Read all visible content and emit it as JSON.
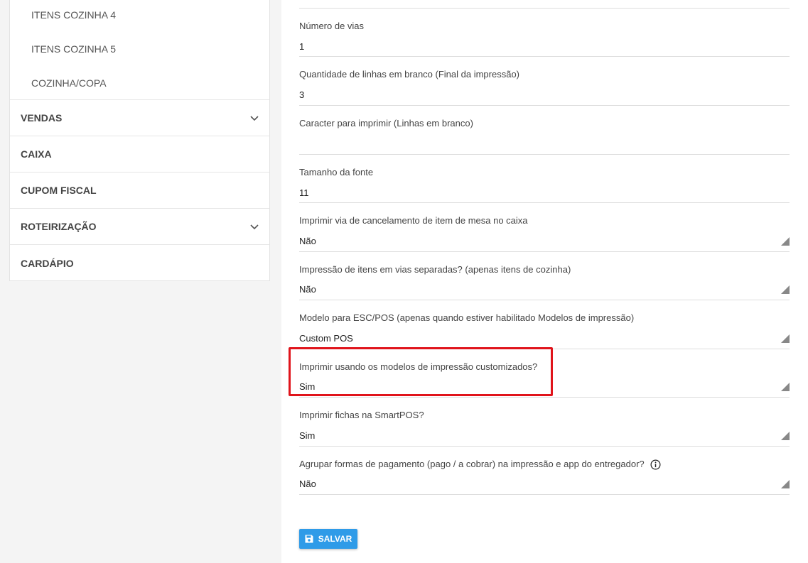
{
  "sidebar": {
    "sub_items": [
      "ITENS COZINHA 4",
      "ITENS COZINHA 5",
      "COZINHA/COPA"
    ],
    "menu_items": [
      {
        "label": "VENDAS",
        "icon": "chevron-down-icon"
      },
      {
        "label": "CAIXA"
      },
      {
        "label": "CUPOM FISCAL"
      },
      {
        "label": "ROTEIRIZAÇÃO",
        "icon": "chevron-down-icon"
      },
      {
        "label": "CARDÁPIO"
      }
    ]
  },
  "form": {
    "fields": [
      {
        "label": "Número de vias",
        "value": "1",
        "type": "input"
      },
      {
        "label": "Quantidade de linhas em branco (Final da impressão)",
        "value": "3",
        "type": "input"
      },
      {
        "label": "Caracter para imprimir (Linhas em branco)",
        "value": "",
        "type": "input"
      },
      {
        "label": "Tamanho da fonte",
        "value": "11",
        "type": "input"
      },
      {
        "label": "Imprimir via de cancelamento de item de mesa no caixa",
        "value": "Não",
        "type": "select"
      },
      {
        "label": "Impressão de itens em vias separadas? (apenas itens de cozinha)",
        "value": "Não",
        "type": "select"
      },
      {
        "label": "Modelo para ESC/POS (apenas quando estiver habilitado Modelos de impressão)",
        "value": "Custom POS",
        "type": "select"
      },
      {
        "label": "Imprimir usando os modelos de impressão customizados?",
        "value": "Sim",
        "type": "select"
      },
      {
        "label": "Imprimir fichas na SmartPOS?",
        "value": "Sim",
        "type": "select"
      },
      {
        "label": "Agrupar formas de pagamento (pago / a cobrar) na impressão e app do entregador?",
        "value": "Não",
        "type": "select"
      }
    ],
    "save_label": "SALVAR"
  },
  "colors": {
    "accent": "#2f9be8",
    "highlight": "#e0141b"
  }
}
